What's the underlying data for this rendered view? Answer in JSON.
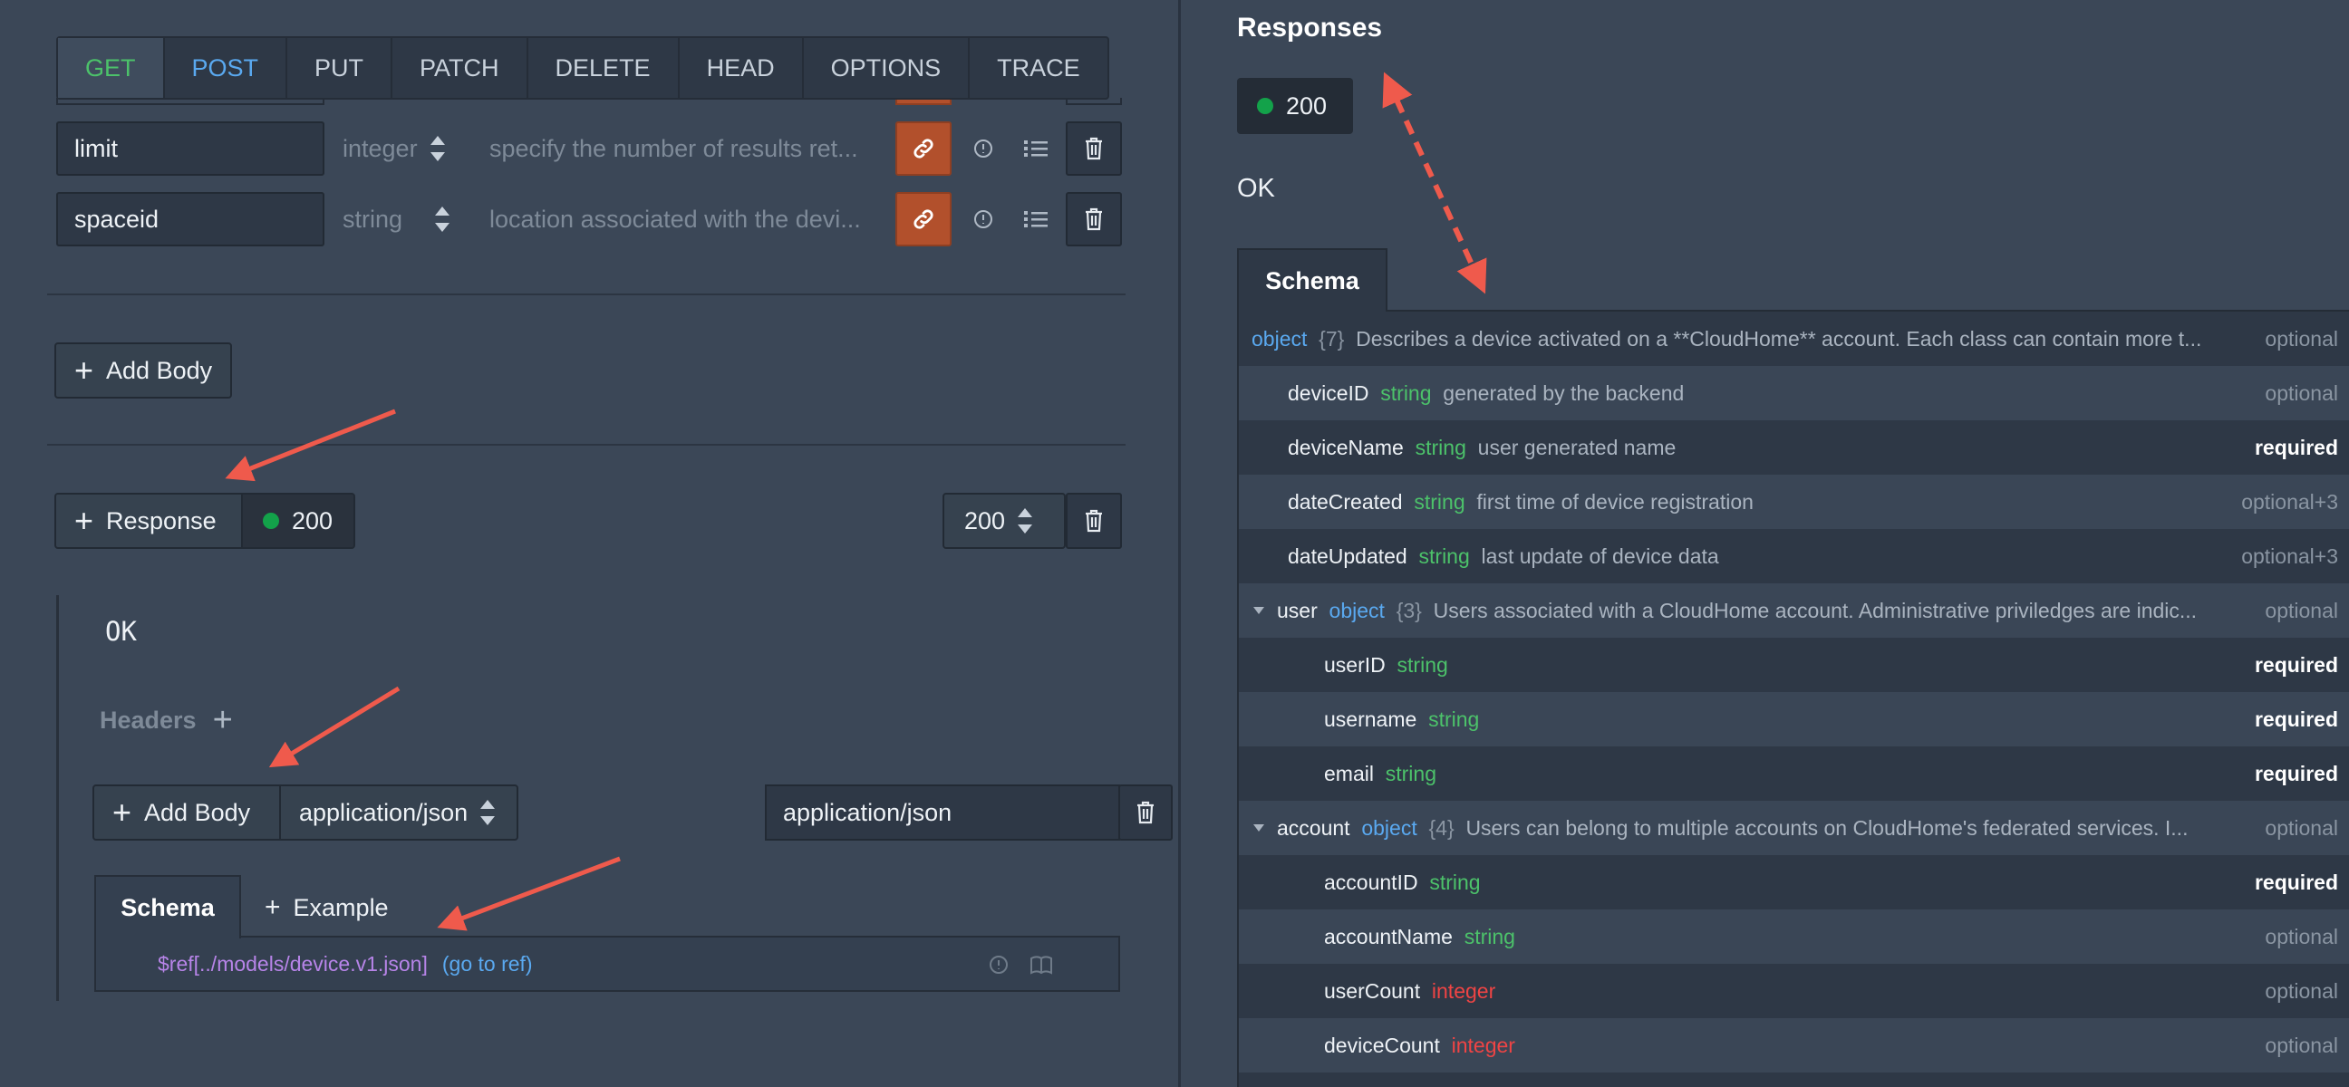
{
  "methods": [
    "GET",
    "POST",
    "PUT",
    "PATCH",
    "DELETE",
    "HEAD",
    "OPTIONS",
    "TRACE"
  ],
  "params": [
    {
      "name": "limit",
      "type": "integer",
      "description": "specify the number of results ret..."
    },
    {
      "name": "spaceid",
      "type": "string",
      "description": "location associated with the devi..."
    }
  ],
  "add_body_label": "Add Body",
  "response": {
    "button_label": "Response",
    "status": "200",
    "code_select": "200",
    "description": "OK",
    "headers_label": "Headers",
    "add_body_label": "Add Body",
    "content_type_select": "application/json",
    "content_type_input": "application/json",
    "tabs": {
      "schema": "Schema",
      "example": "Example"
    },
    "ref_text": "$ref[../models/device.v1.json]",
    "go_to_ref": "(go to ref)"
  },
  "preview": {
    "title": "Responses",
    "status": "200",
    "description": "OK",
    "tab": "Schema",
    "rows": [
      {
        "indent": 0,
        "toggle": false,
        "name": "",
        "type": "object",
        "kind": "obj",
        "count": "{7}",
        "desc": "Describes a device activated on a **CloudHome** account. Each class can contain more t...",
        "req": "optional",
        "bold": false
      },
      {
        "indent": 1,
        "toggle": false,
        "name": "deviceID",
        "type": "string",
        "kind": "str",
        "count": "",
        "desc": "generated by the backend",
        "req": "optional",
        "bold": false
      },
      {
        "indent": 1,
        "toggle": false,
        "name": "deviceName",
        "type": "string",
        "kind": "str",
        "count": "",
        "desc": "user generated name",
        "req": "required",
        "bold": true
      },
      {
        "indent": 1,
        "toggle": false,
        "name": "dateCreated",
        "type": "string",
        "kind": "str",
        "count": "",
        "desc": "first time of device registration",
        "req": "optional+3",
        "bold": false
      },
      {
        "indent": 1,
        "toggle": false,
        "name": "dateUpdated",
        "type": "string",
        "kind": "str",
        "count": "",
        "desc": "last update of device data",
        "req": "optional+3",
        "bold": false
      },
      {
        "indent": 1,
        "toggle": true,
        "name": "user",
        "type": "object",
        "kind": "obj",
        "count": "{3}",
        "desc": "Users associated with a CloudHome account. Administrative priviledges are indic...",
        "req": "optional",
        "bold": false
      },
      {
        "indent": 2,
        "toggle": false,
        "name": "userID",
        "type": "string",
        "kind": "str",
        "count": "",
        "desc": "",
        "req": "required",
        "bold": true
      },
      {
        "indent": 2,
        "toggle": false,
        "name": "username",
        "type": "string",
        "kind": "str",
        "count": "",
        "desc": "",
        "req": "required",
        "bold": true
      },
      {
        "indent": 2,
        "toggle": false,
        "name": "email",
        "type": "string",
        "kind": "str",
        "count": "",
        "desc": "",
        "req": "required",
        "bold": true
      },
      {
        "indent": 1,
        "toggle": true,
        "name": "account",
        "type": "object",
        "kind": "obj",
        "count": "{4}",
        "desc": "Users can belong to multiple accounts on CloudHome's federated services. I...",
        "req": "optional",
        "bold": false
      },
      {
        "indent": 2,
        "toggle": false,
        "name": "accountID",
        "type": "string",
        "kind": "str",
        "count": "",
        "desc": "",
        "req": "required",
        "bold": true
      },
      {
        "indent": 2,
        "toggle": false,
        "name": "accountName",
        "type": "string",
        "kind": "str",
        "count": "",
        "desc": "",
        "req": "optional",
        "bold": false
      },
      {
        "indent": 2,
        "toggle": false,
        "name": "userCount",
        "type": "integer",
        "kind": "int",
        "count": "",
        "desc": "",
        "req": "optional",
        "bold": false
      },
      {
        "indent": 2,
        "toggle": false,
        "name": "deviceCount",
        "type": "integer",
        "kind": "int",
        "count": "",
        "desc": "",
        "req": "optional",
        "bold": false
      }
    ]
  },
  "colors": {
    "background": "#3b4757",
    "accent_get": "#4cc26a",
    "accent_post": "#5aa9f0",
    "link_button": "#b2502c",
    "status_dot": "#13a24a",
    "type_string": "#4cc26a",
    "type_object": "#5aa9f0",
    "type_integer": "#ef4444",
    "annotation_arrow": "#ef5a4c"
  }
}
